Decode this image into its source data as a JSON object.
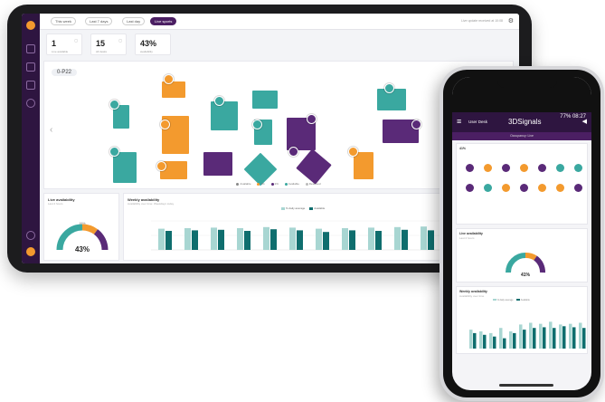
{
  "tablet": {
    "tabs": [
      {
        "label": "This week"
      },
      {
        "label": "Last 7 days"
      },
      {
        "label": "Last day"
      },
      {
        "label": "Live sports",
        "active": true
      }
    ],
    "top_note": "Live update received at 10:08",
    "stats": [
      {
        "value": "1",
        "label": "Live available"
      },
      {
        "value": "15",
        "label": "All desks"
      },
      {
        "value": "43%",
        "label": "availability"
      }
    ],
    "floor_label": "0-P22",
    "legend": [
      {
        "label": "Available",
        "color": "#888888"
      },
      {
        "label": "1%",
        "color": "#f39a2e"
      },
      {
        "label": "2%",
        "color": "#5a2a78"
      },
      {
        "label": "Available",
        "color": "#3aa8a0"
      },
      {
        "label": "Reserved",
        "color": "#bbbbbb"
      }
    ],
    "live_card": {
      "title": "Live availability",
      "subtitle": "Last 2 hours",
      "gauge_value": "43%",
      "gauge_top": "19%",
      "percent": 43
    },
    "weekly_card": {
      "title": "Weekly availability",
      "subtitle": "Availability over time: Weekdays today",
      "legend_a": "% daily average",
      "legend_b": "Available"
    },
    "colors": {
      "teal": "#3aa8a0",
      "orange": "#f39a2e",
      "purple": "#5a2a78",
      "dark": "#2e1540"
    }
  },
  "phone": {
    "status": "77% 08:27",
    "app_name": "User Desk",
    "logo": "3DSignals",
    "subbar": "Occupancy: Live",
    "stat_value": "41%",
    "live_title": "Live availability",
    "live_sub": "Last 2 hours",
    "gauge_value": "41%",
    "weekly_title": "Weekly availability",
    "weekly_sub": "Availability over time",
    "weekly_legend_a": "% daily average",
    "weekly_legend_b": "Available"
  }
}
